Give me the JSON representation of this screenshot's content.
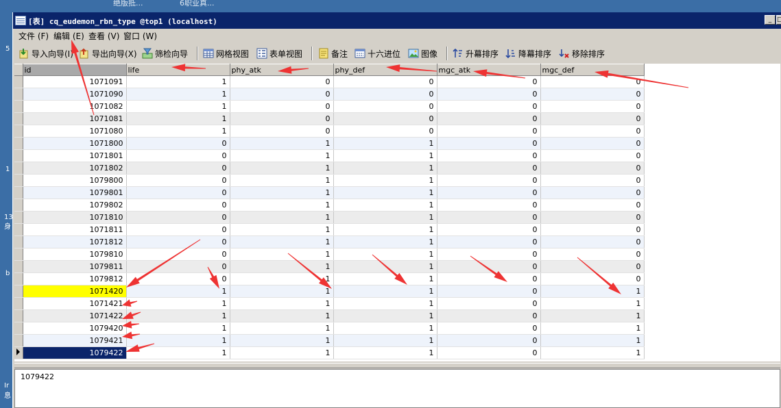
{
  "background": {
    "top_text_1": "绝版抵...",
    "top_text_2": "6职业真...",
    "left_glyphs": [
      "5",
      "1",
      "13",
      "身",
      "b",
      "Ir",
      "息"
    ]
  },
  "window": {
    "title": "[表] cq_eudemon_rbn_type @top1 (localhost)",
    "minimize_glyph": "_",
    "maximize_glyph": "□"
  },
  "menu": [
    "文件 (F)",
    "编辑 (E)",
    "查看 (V)",
    "窗口 (W)"
  ],
  "toolbar": [
    {
      "label": "导入向导(I)",
      "icon": "import-icon"
    },
    {
      "label": "导出向导(X)",
      "icon": "export-icon"
    },
    {
      "label": "筛检向导",
      "icon": "filter-wizard-icon"
    },
    {
      "label": "网格视图",
      "icon": "grid-view-icon"
    },
    {
      "label": "表单视图",
      "icon": "form-view-icon"
    },
    {
      "label": "备注",
      "icon": "memo-icon"
    },
    {
      "label": "十六进位",
      "icon": "hex-icon"
    },
    {
      "label": "图像",
      "icon": "image-icon"
    },
    {
      "label": "升幕排序",
      "icon": "sort-asc-icon"
    },
    {
      "label": "降幕排序",
      "icon": "sort-desc-icon"
    },
    {
      "label": "移除排序",
      "icon": "remove-sort-icon"
    }
  ],
  "columns": [
    "id",
    "life",
    "phy_atk",
    "phy_def",
    "mgc_atk",
    "mgc_def"
  ],
  "rows": [
    [
      "1071091",
      "1",
      "0",
      "0",
      "0",
      "0"
    ],
    [
      "1071090",
      "1",
      "0",
      "0",
      "0",
      "0"
    ],
    [
      "1071082",
      "1",
      "0",
      "0",
      "0",
      "0"
    ],
    [
      "1071081",
      "1",
      "0",
      "0",
      "0",
      "0"
    ],
    [
      "1071080",
      "1",
      "0",
      "0",
      "0",
      "0"
    ],
    [
      "1071800",
      "0",
      "1",
      "1",
      "0",
      "0"
    ],
    [
      "1071801",
      "0",
      "1",
      "1",
      "0",
      "0"
    ],
    [
      "1071802",
      "0",
      "1",
      "1",
      "0",
      "0"
    ],
    [
      "1079800",
      "0",
      "1",
      "1",
      "0",
      "0"
    ],
    [
      "1079801",
      "0",
      "1",
      "1",
      "0",
      "0"
    ],
    [
      "1079802",
      "0",
      "1",
      "1",
      "0",
      "0"
    ],
    [
      "1071810",
      "0",
      "1",
      "1",
      "0",
      "0"
    ],
    [
      "1071811",
      "0",
      "1",
      "1",
      "0",
      "0"
    ],
    [
      "1071812",
      "0",
      "1",
      "1",
      "0",
      "0"
    ],
    [
      "1079810",
      "0",
      "1",
      "1",
      "0",
      "0"
    ],
    [
      "1079811",
      "0",
      "1",
      "1",
      "0",
      "0"
    ],
    [
      "1079812",
      "0",
      "1",
      "1",
      "0",
      "0"
    ],
    [
      "1071420",
      "1",
      "1",
      "1",
      "0",
      "1"
    ],
    [
      "1071421",
      "1",
      "1",
      "1",
      "0",
      "1"
    ],
    [
      "1071422",
      "1",
      "1",
      "1",
      "0",
      "1"
    ],
    [
      "1079420",
      "1",
      "1",
      "1",
      "0",
      "1"
    ],
    [
      "1079421",
      "1",
      "1",
      "1",
      "0",
      "1"
    ],
    [
      "1079422",
      "1",
      "1",
      "1",
      "0",
      "1"
    ]
  ],
  "highlighted_row_id": "1071420",
  "selected_row_id": "1079422",
  "detail_value": "1079422",
  "colors": {
    "titlebar": "#0a246a",
    "annotation_arrow": "#ee3333",
    "highlight": "#ffff00",
    "selection": "#0a246a"
  }
}
